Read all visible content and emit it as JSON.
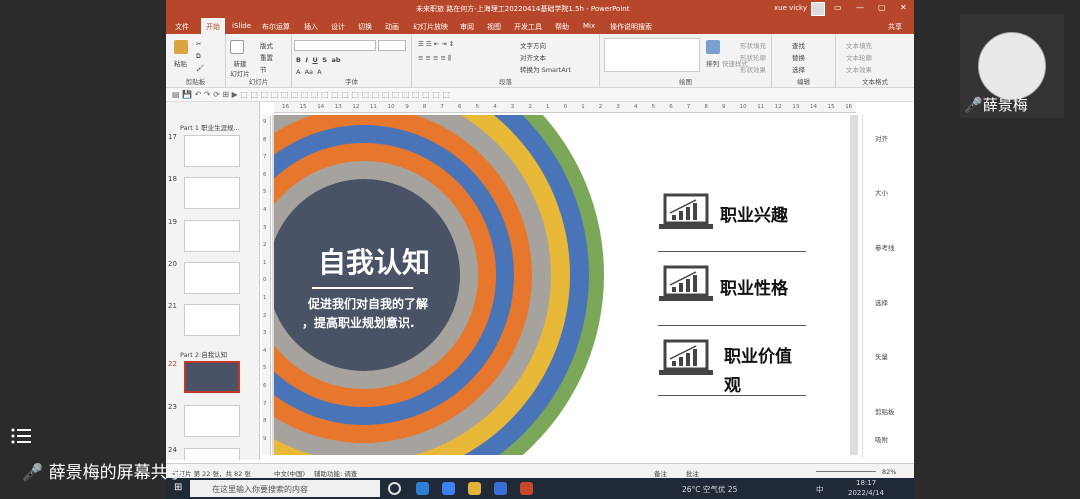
{
  "window": {
    "title": "未来职旅 路在何方-上海理工20220414基础学院1.5h - PowerPoint",
    "user": "xue vicky"
  },
  "menu": {
    "items": [
      "文件",
      "开始",
      "iSlide",
      "布尔运算",
      "插入",
      "设计",
      "切换",
      "动画",
      "幻灯片放映",
      "审阅",
      "视图",
      "开发工具",
      "帮助",
      "Mix",
      "操作说明搜索",
      "共享"
    ]
  },
  "ribbon": {
    "groups": [
      "剪贴板",
      "幻灯片",
      "字体",
      "段落",
      "绘图",
      "编辑"
    ],
    "paste": "粘贴",
    "new_slide": "新建\n幻灯片",
    "layout": "版式",
    "reset": "重置",
    "section": "节",
    "text_direction": "文字方向",
    "align_text": "对齐文本",
    "smartart": "转换为 SmartArt",
    "arrange": "排列",
    "quick_styles": "快速样式",
    "shape_fill": "形状填充",
    "shape_outline": "形状轮廓",
    "shape_effects": "形状效果",
    "find": "查找",
    "replace": "替换",
    "select": "选择",
    "text_fill": "文本填充",
    "text_outline": "文本轮廓",
    "text_effects": "文本效果",
    "text_format": "文本格式"
  },
  "thumbnails": {
    "section1": "Part 1 职业生涯规...",
    "section2": "Part 2:自我认知",
    "numbers": [
      "17",
      "18",
      "19",
      "20",
      "21",
      "22",
      "23",
      "24"
    ]
  },
  "slide": {
    "title": "自我认知",
    "sub1": "促进我们对自我的了解",
    "sub2": "，提高职业规划意识.",
    "items": [
      "职业兴趣",
      "职业性格",
      "职业价值",
      "观"
    ],
    "ring_colors": [
      "#7aa858",
      "#4a74b8",
      "#e8b838",
      "#a6a39e",
      "#e8772e",
      "#4a74b8",
      "#e8772e",
      "#a6a39e"
    ],
    "core_color": "#4a5366"
  },
  "rightpane": {
    "labels": [
      "对齐",
      "大小",
      "参考线",
      "选择",
      "矢量",
      "剪贴板",
      "吸附"
    ]
  },
  "status": {
    "slide": "幻灯片 第 22 张，共 82 张",
    "lang": "中文(中国)",
    "access": "辅助功能: 调查",
    "notes": "备注",
    "comments": "批注",
    "zoom": "82%"
  },
  "taskbar": {
    "search": "在这里输入你要搜索的内容",
    "weather": "26°C 空气优 25",
    "time": "18:17",
    "date": "2022/4/14",
    "ime": "中"
  },
  "webcam": {
    "name": "薛景梅"
  },
  "share": {
    "label": "薛景梅的屏幕共享"
  }
}
